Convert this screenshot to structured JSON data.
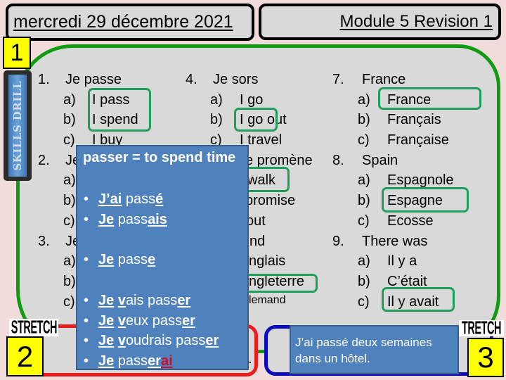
{
  "slide": {
    "header": {
      "date": "mercredi 29 décembre 2021",
      "title": "Module 5 Revision 1"
    },
    "colors": {
      "slide_bg": "#f2dcdb",
      "panel_bg": "#d9d9d9",
      "box1_border": "#109c10",
      "box2_border": "#ec1c1c",
      "box3_border": "#0b0bbf",
      "highlight_border": "#1e9e58",
      "info_box_bg": "#4f81bd",
      "info_box_border": "#385d8a",
      "badge_bg": "#ffff00"
    }
  },
  "section_1": {
    "badge": "1",
    "skills_drill_label": "SKILLS DRILL",
    "questions": [
      {
        "number": "1.",
        "prompt": "Je passe",
        "options": [
          {
            "letter": "a)",
            "text": "I pass",
            "highlighted": true
          },
          {
            "letter": "b)",
            "text": "I spend",
            "highlighted": true
          },
          {
            "letter": "c)",
            "text": "I buy",
            "highlighted": false
          }
        ]
      },
      {
        "number": "2.",
        "prompt": "Je",
        "options": [
          {
            "letter": "a)"
          },
          {
            "letter": "b)"
          },
          {
            "letter": "c)"
          }
        ]
      },
      {
        "number": "3.",
        "prompt": "Je",
        "options": [
          {
            "letter": "a)"
          },
          {
            "letter": "b)"
          },
          {
            "letter": "c)"
          }
        ]
      },
      {
        "number": "4.",
        "prompt": "Je sors",
        "options": [
          {
            "letter": "a)",
            "text": "I go",
            "highlighted": false
          },
          {
            "letter": "b)",
            "text": "I go out",
            "highlighted": true
          },
          {
            "letter": "c)",
            "text": "I travel",
            "highlighted": false
          }
        ]
      },
      {
        "prompt": "e promène",
        "options": [
          {
            "text": "walk",
            "highlighted": true
          },
          {
            "text": "promise",
            "highlighted": false
          },
          {
            "text": "out",
            "highlighted": false
          }
        ]
      },
      {
        "prompt": "nd",
        "options": [
          {
            "text": "nglais",
            "highlighted": false
          },
          {
            "text": "ngleterre",
            "highlighted": true
          },
          {
            "text": "lemand",
            "highlighted": false
          }
        ]
      },
      {
        "number": "7.",
        "prompt": "France",
        "options": [
          {
            "letter": "a)",
            "text": "France",
            "highlighted": true
          },
          {
            "letter": "b)",
            "text": "Français",
            "highlighted": false
          },
          {
            "letter": "c)",
            "text": "Française",
            "highlighted": false
          }
        ]
      },
      {
        "number": "8.",
        "prompt": "Spain",
        "options": [
          {
            "letter": "a)",
            "text": "Espagnole",
            "highlighted": false
          },
          {
            "letter": "b)",
            "text": "Espagne",
            "highlighted": true
          },
          {
            "letter": "c)",
            "text": "Ecosse",
            "highlighted": false
          }
        ]
      },
      {
        "number": "9.",
        "prompt": "There was",
        "options": [
          {
            "letter": "a)",
            "text": "Il y a",
            "highlighted": false
          },
          {
            "letter": "b)",
            "text": "C’était",
            "highlighted": false
          },
          {
            "letter": "c)",
            "text": "Il y avait",
            "highlighted": true
          }
        ]
      }
    ]
  },
  "grammar_box": {
    "title": "passer = to spend time",
    "bullets": [
      {
        "segments": [
          {
            "text": "J’ai",
            "em": true
          },
          {
            "text": " pass"
          },
          {
            "text": "é",
            "em": true
          }
        ]
      },
      {
        "segments": [
          {
            "text": "Je",
            "em": true
          },
          {
            "text": " pass"
          },
          {
            "text": "ais",
            "em": true
          }
        ]
      },
      {
        "segments": [
          {
            "text": "Je",
            "em": true
          },
          {
            "text": " pass"
          },
          {
            "text": "e",
            "em": true
          }
        ]
      },
      {
        "segments": [
          {
            "text": "Je",
            "em": true
          },
          {
            "text": " "
          },
          {
            "text": "v",
            "em": true
          },
          {
            "text": "ais pass"
          },
          {
            "text": "er",
            "em": true
          }
        ]
      },
      {
        "segments": [
          {
            "text": "Je",
            "em": true
          },
          {
            "text": " "
          },
          {
            "text": "v",
            "em": true
          },
          {
            "text": "eux pass"
          },
          {
            "text": "er",
            "em": true
          }
        ]
      },
      {
        "segments": [
          {
            "text": "Je",
            "em": true
          },
          {
            "text": " "
          },
          {
            "text": "v",
            "em": true
          },
          {
            "text": "oudrais pass"
          },
          {
            "text": "er",
            "em": true
          }
        ]
      },
      {
        "segments": [
          {
            "text": "Je",
            "em": true
          },
          {
            "text": " pass"
          },
          {
            "text": "er",
            "em": true
          },
          {
            "text": "ai",
            "em": true,
            "color": "#c8102e"
          }
        ]
      }
    ]
  },
  "section_2": {
    "badge": "2",
    "label": "STRETCH",
    "visible_fragment": "."
  },
  "section_3": {
    "badge": "3",
    "label": "TRETCH",
    "text": "J’ai passé deux semaines dans un hôtel."
  }
}
